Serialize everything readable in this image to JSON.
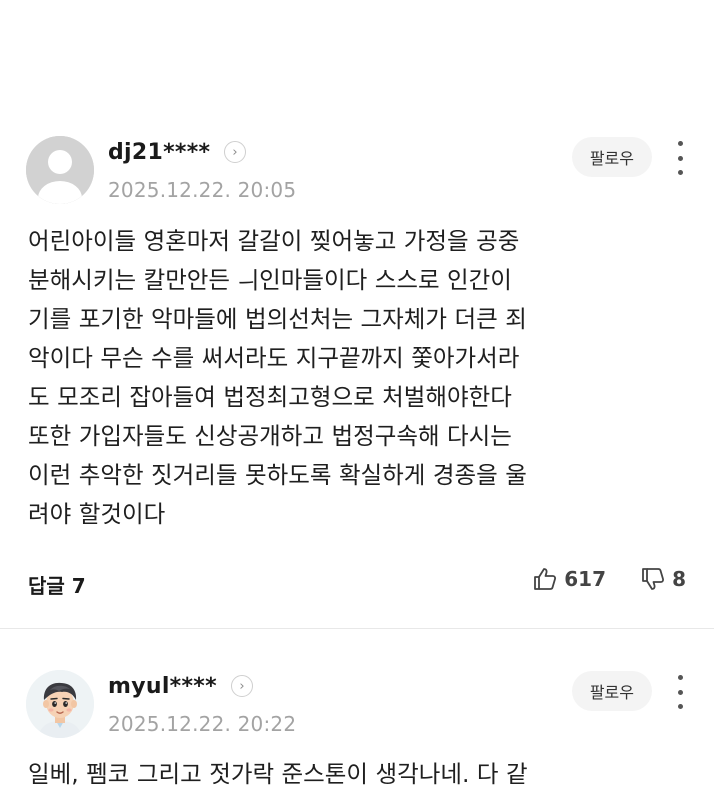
{
  "comments": [
    {
      "username": "dj21****",
      "timestamp": "2025.12.22. 20:05",
      "follow_label": "팔로우",
      "avatar_icon": "default-person-avatar",
      "body": "어린아이들 영혼마저 갈갈이 찢어놓고 가정을 공중\n분해시키는 칼만안든 ㅢ인마들이다 스스로 인간이\n기를 포기한 악마들에 법의선처는 그자체가 더큰 죄\n악이다 무슨 수를 써서라도 지구끝까지 쫓아가서라\n도 모조리 잡아들여 법정최고형으로 처벌해야한다\n또한 가입자들도 신상공개하고 법정구속해 다시는\n이런 추악한 짓거리들 못하도록 확실하게 경종을 울\n려야 할것이다",
      "reply_label": "답글 7",
      "like_count": "617",
      "dislike_count": "8"
    },
    {
      "username": "myul****",
      "timestamp": "2025.12.22. 20:22",
      "follow_label": "팔로우",
      "avatar_icon": "cartoon-boy-avatar",
      "body": "일베, 펨코 그리고 젓가락 준스톤이 생각나네. 다 같"
    }
  ],
  "colors": {
    "text": "#1f1f1f",
    "meta": "#a3a3a3",
    "follow_bg": "#f4f4f4",
    "default_avatar": "#d2d2d2"
  }
}
